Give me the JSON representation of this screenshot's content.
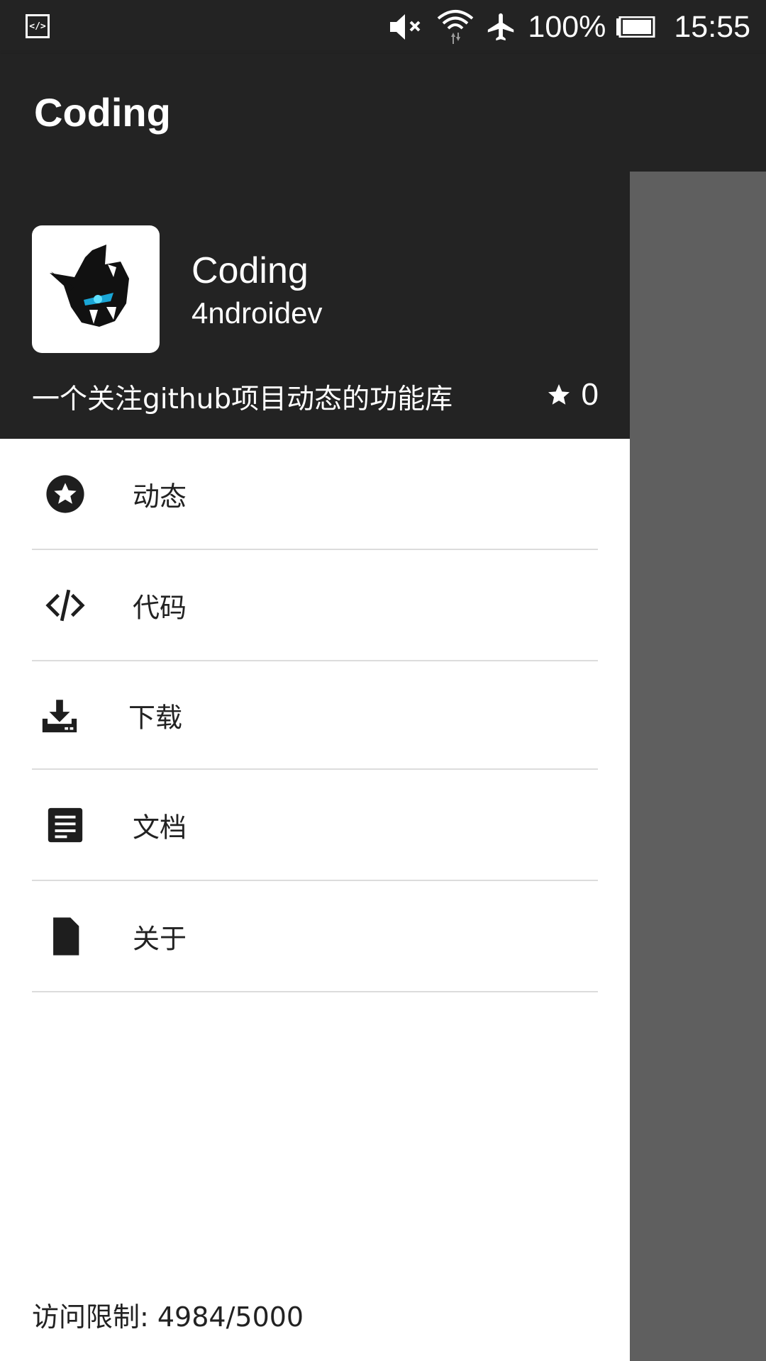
{
  "status_bar": {
    "battery": "100%",
    "time": "15:55"
  },
  "app_bar": {
    "title": "Coding"
  },
  "drawer": {
    "header": {
      "repo_name": "Coding",
      "owner": "4ndroidev",
      "description": "一个关注github项目动态的功能库",
      "star_count": "0"
    },
    "menu": [
      {
        "icon": "star-circle-icon",
        "label": "动态"
      },
      {
        "icon": "code-icon",
        "label": "代码"
      },
      {
        "icon": "download-icon",
        "label": "下载"
      },
      {
        "icon": "document-icon",
        "label": "文档"
      },
      {
        "icon": "file-icon",
        "label": "关于"
      }
    ],
    "footer": "访问限制: 4984/5000"
  },
  "colors": {
    "header_bg": "#232323",
    "scrim": "#5f5f5f",
    "divider": "#dcdcdc"
  }
}
